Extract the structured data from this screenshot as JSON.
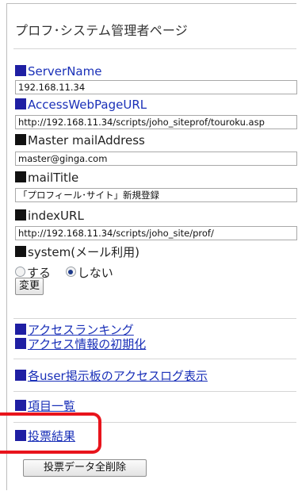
{
  "page": {
    "title": "プロフ･システム管理者ページ"
  },
  "settings": {
    "server_name": {
      "label": "ServerName",
      "value": "192.168.11.34"
    },
    "access_url": {
      "label": "AccessWebPageURL",
      "value": "http://192.168.11.34/scripts/joho_siteprof/touroku.asp"
    },
    "master_mail": {
      "label": "Master mailAddress",
      "value": "master@ginga.com"
    },
    "mail_title": {
      "label": "mailTitle",
      "value": "「プロフィール･サイト」新規登録"
    },
    "index_url": {
      "label": "indexURL",
      "value": "http://192.168.11.34/scripts/joho_site/prof/"
    },
    "system": {
      "label": "system(メール利用)",
      "options": [
        "する",
        "しない"
      ],
      "selected": "しない"
    },
    "change_button": "変更"
  },
  "links": {
    "access_ranking": "アクセスランキング",
    "access_reset": "アクセス情報の初期化",
    "user_board_log": "各user掲示板のアクセスログ表示",
    "item_list": "項目一覧",
    "vote_results": "投票結果"
  },
  "actions": {
    "delete_vote_data": "投票データ全削除"
  },
  "colors": {
    "link_blue": "#1a30b8",
    "highlight_red": "#e8141c"
  }
}
